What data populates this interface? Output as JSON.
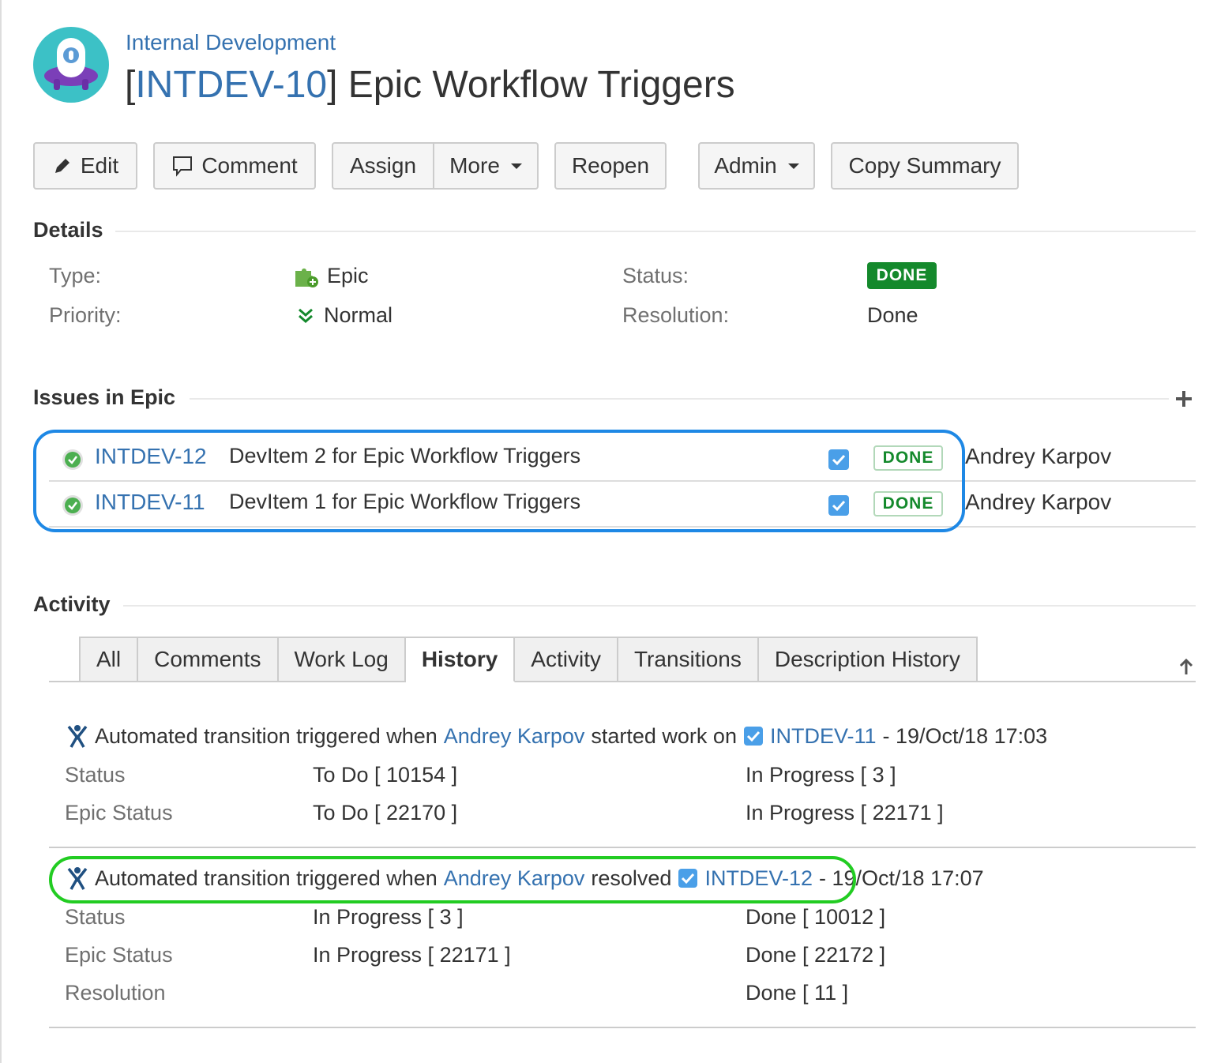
{
  "header": {
    "project_name": "Internal Development",
    "issue_key": "INTDEV-10",
    "issue_summary": "Epic Workflow Triggers"
  },
  "toolbar": {
    "edit": "Edit",
    "comment": "Comment",
    "assign": "Assign",
    "more": "More",
    "reopen": "Reopen",
    "admin": "Admin",
    "copy_summary": "Copy Summary"
  },
  "details": {
    "heading": "Details",
    "type_label": "Type:",
    "type_value": "Epic",
    "priority_label": "Priority:",
    "priority_value": "Normal",
    "status_label": "Status:",
    "status_value": "DONE",
    "resolution_label": "Resolution:",
    "resolution_value": "Done"
  },
  "issues_in_epic": {
    "heading": "Issues in Epic",
    "rows": [
      {
        "key": "INTDEV-12",
        "summary": "DevItem 2 for Epic Workflow Triggers",
        "status": "DONE",
        "assignee": "Andrey Karpov"
      },
      {
        "key": "INTDEV-11",
        "summary": "DevItem 1 for Epic Workflow Triggers",
        "status": "DONE",
        "assignee": "Andrey Karpov"
      }
    ]
  },
  "activity": {
    "heading": "Activity",
    "tabs": [
      "All",
      "Comments",
      "Work Log",
      "History",
      "Activity",
      "Transitions",
      "Description History"
    ],
    "active_tab": "History",
    "entries": [
      {
        "prefix": "Automated transition triggered when",
        "user": "Andrey Karpov",
        "action": "started work on",
        "issue": "INTDEV-11",
        "timestamp": "- 19/Oct/18 17:03",
        "changes": [
          {
            "field": "Status",
            "old": "To Do [ 10154 ]",
            "new": "In Progress [ 3 ]"
          },
          {
            "field": "Epic Status",
            "old": "To Do [ 22170 ]",
            "new": "In Progress [ 22171 ]"
          }
        ]
      },
      {
        "prefix": "Automated transition triggered when",
        "user": "Andrey Karpov",
        "action": "resolved",
        "issue": "INTDEV-12",
        "timestamp": "- 19/Oct/18 17:07",
        "changes": [
          {
            "field": "Status",
            "old": "In Progress [ 3 ]",
            "new": "Done [ 10012 ]"
          },
          {
            "field": "Epic Status",
            "old": "In Progress [ 22171 ]",
            "new": "Done [ 22172 ]"
          },
          {
            "field": "Resolution",
            "old": "",
            "new": "Done [ 11 ]"
          }
        ]
      }
    ]
  },
  "colors": {
    "link": "#3572b0",
    "done_green": "#14892c",
    "highlight_blue": "#1e88e5",
    "highlight_green": "#22cc22"
  }
}
